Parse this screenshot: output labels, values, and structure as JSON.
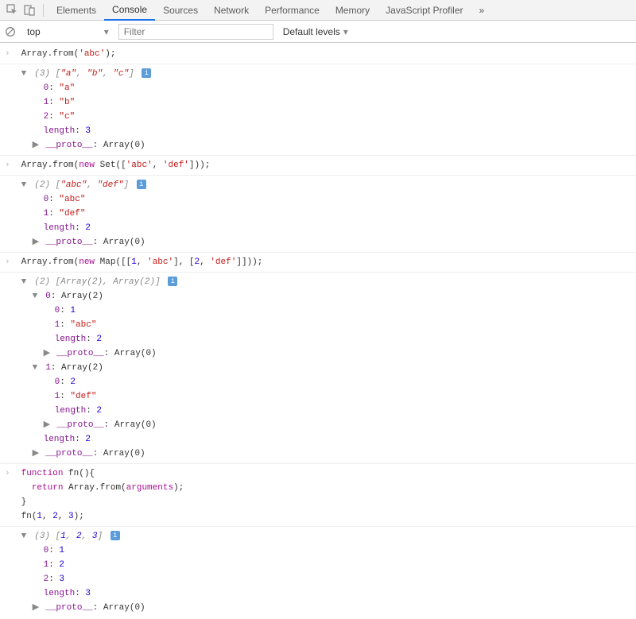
{
  "toolbar": {
    "tabs": [
      "Elements",
      "Console",
      "Sources",
      "Network",
      "Performance",
      "Memory",
      "JavaScript Profiler"
    ],
    "activeTab": "Console",
    "more": "»"
  },
  "filterbar": {
    "context": "top",
    "filterPlaceholder": "Filter",
    "levels": "Default levels"
  },
  "tokens": {
    "arrayFrom": "Array.from",
    "newKw": "new",
    "setCtor": "Set",
    "mapCtor": "Map",
    "functionKw": "function",
    "returnKw": "return",
    "argumentsKw": "arguments",
    "lengthProp": "length",
    "protoProp": "__proto__",
    "fnName": "fn",
    "arrayZero": "Array(0)",
    "arrayTwo": "Array(2)"
  },
  "entry1": {
    "input": "'abc'",
    "header": {
      "count": "(3)",
      "preview": [
        "\"a\"",
        "\"b\"",
        "\"c\""
      ]
    },
    "items": [
      {
        "key": "0",
        "val": "\"a\""
      },
      {
        "key": "1",
        "val": "\"b\""
      },
      {
        "key": "2",
        "val": "\"c\""
      }
    ],
    "length": "3"
  },
  "entry2": {
    "input": [
      "'abc'",
      "'def'"
    ],
    "header": {
      "count": "(2)",
      "preview": [
        "\"abc\"",
        "\"def\""
      ]
    },
    "items": [
      {
        "key": "0",
        "val": "\"abc\""
      },
      {
        "key": "1",
        "val": "\"def\""
      }
    ],
    "length": "2"
  },
  "entry3": {
    "inputPairs": [
      [
        "1",
        "'abc'"
      ],
      [
        "2",
        "'def'"
      ]
    ],
    "header": {
      "count": "(2)",
      "preview": [
        "Array(2)",
        "Array(2)"
      ]
    },
    "sub0": {
      "key": "0",
      "head": "Array(2)",
      "items": [
        {
          "key": "0",
          "val": "1",
          "num": true
        },
        {
          "key": "1",
          "val": "\"abc\""
        }
      ],
      "length": "2"
    },
    "sub1": {
      "key": "1",
      "head": "Array(2)",
      "items": [
        {
          "key": "0",
          "val": "2",
          "num": true
        },
        {
          "key": "1",
          "val": "\"def\""
        }
      ],
      "length": "2"
    },
    "length": "2"
  },
  "entry4": {
    "callArgs": [
      "1",
      "2",
      "3"
    ],
    "header": {
      "count": "(3)",
      "preview": [
        "1",
        "2",
        "3"
      ]
    },
    "items": [
      {
        "key": "0",
        "val": "1"
      },
      {
        "key": "1",
        "val": "2"
      },
      {
        "key": "2",
        "val": "3"
      }
    ],
    "length": "3"
  }
}
